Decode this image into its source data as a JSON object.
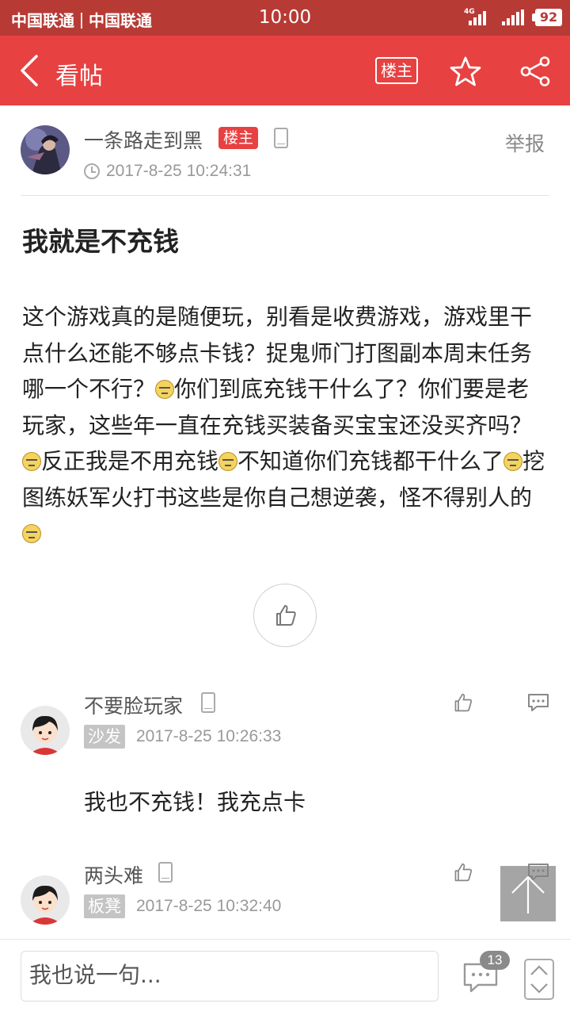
{
  "status_bar": {
    "carrier_1": "中国联通",
    "carrier_2": "中国联通",
    "time": "10:00",
    "network": "4G",
    "battery": "92"
  },
  "app_bar": {
    "title": "看帖",
    "owner_button": "楼主",
    "icons": [
      "back-icon",
      "star-icon",
      "share-icon"
    ]
  },
  "post": {
    "author": "一条路走到黑",
    "owner_badge": "楼主",
    "report": "举报",
    "time": "2017-8-25 10:24:31",
    "title": "我就是不充钱",
    "body": [
      "这个游戏真的是随便玩，别看是收费游戏，游戏里干点什么还能不够点卡钱？捉鬼师门打图副本周末任务哪一个不行？",
      "你们到底充钱干什么了？你们要是老玩家，这些年一直在充钱买装备买宝宝还没买齐吗？",
      "反正我是不用充钱",
      "不知道你们充钱都干什么了",
      "挖图练妖军火打书这些是你自己想逆袭，怪不得别人的",
      ""
    ]
  },
  "replies": [
    {
      "name": "不要脸玩家",
      "floor": "沙发",
      "time": "2017-8-25 10:26:33",
      "text": "我也不充钱！我充点卡"
    },
    {
      "name": "两头难",
      "floor": "板凳",
      "time": "2017-8-25 10:32:40",
      "text": ""
    }
  ],
  "bottom_bar": {
    "input_placeholder": "我也说一句...",
    "comment_count": "13"
  },
  "colors": {
    "status_bar": "#b83a35",
    "app_bar": "#e84141",
    "floor_badge": "#c4c4c4"
  }
}
